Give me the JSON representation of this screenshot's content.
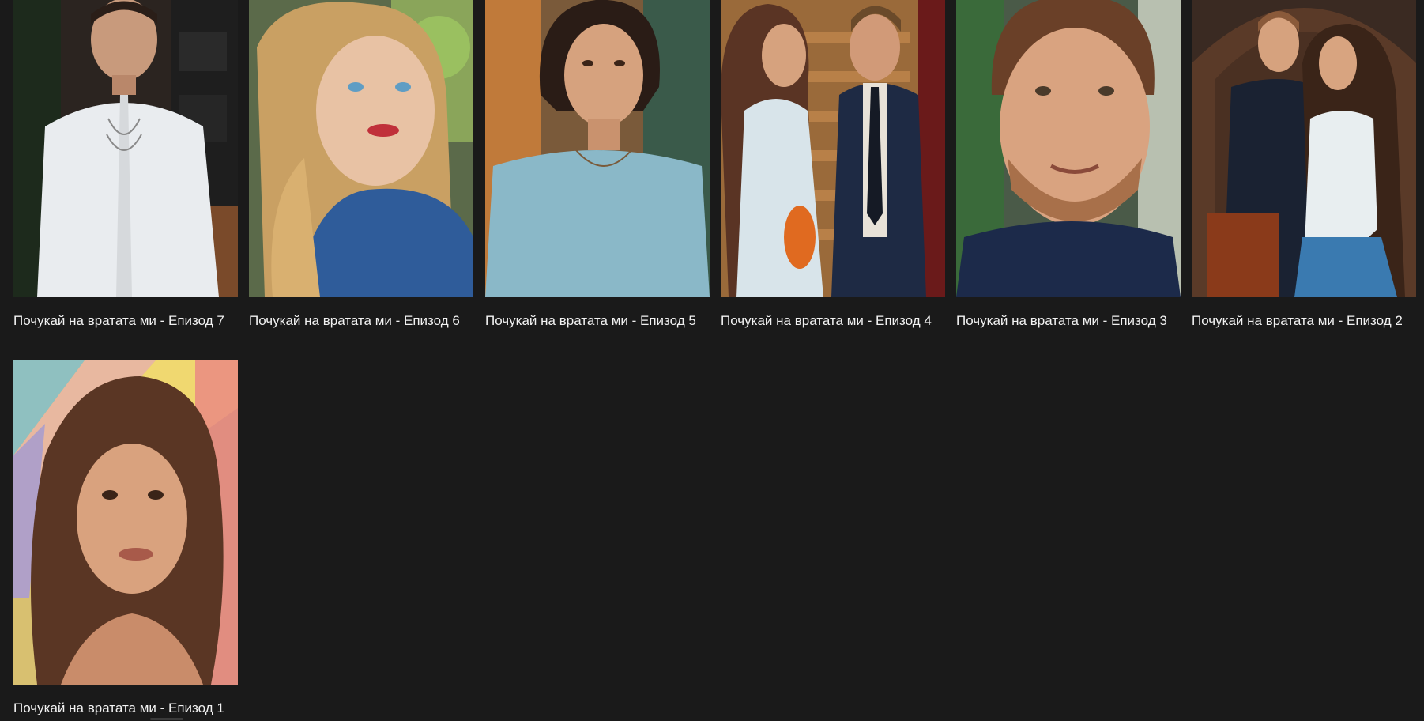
{
  "episodes": [
    {
      "title": "Почукай на вратата ми - Епизод 7"
    },
    {
      "title": "Почукай на вратата ми - Епизод 6"
    },
    {
      "title": "Почукай на вратата ми - Епизод 5"
    },
    {
      "title": "Почукай на вратата ми - Епизод 4"
    },
    {
      "title": "Почукай на вратата ми - Епизод 3"
    },
    {
      "title": "Почукай на вратата ми - Епизод 2"
    },
    {
      "title": "Почукай на вратата ми - Епизод 1"
    }
  ],
  "colors": {
    "background": "#1a1a1a",
    "title_text": "#f2f2f2"
  }
}
